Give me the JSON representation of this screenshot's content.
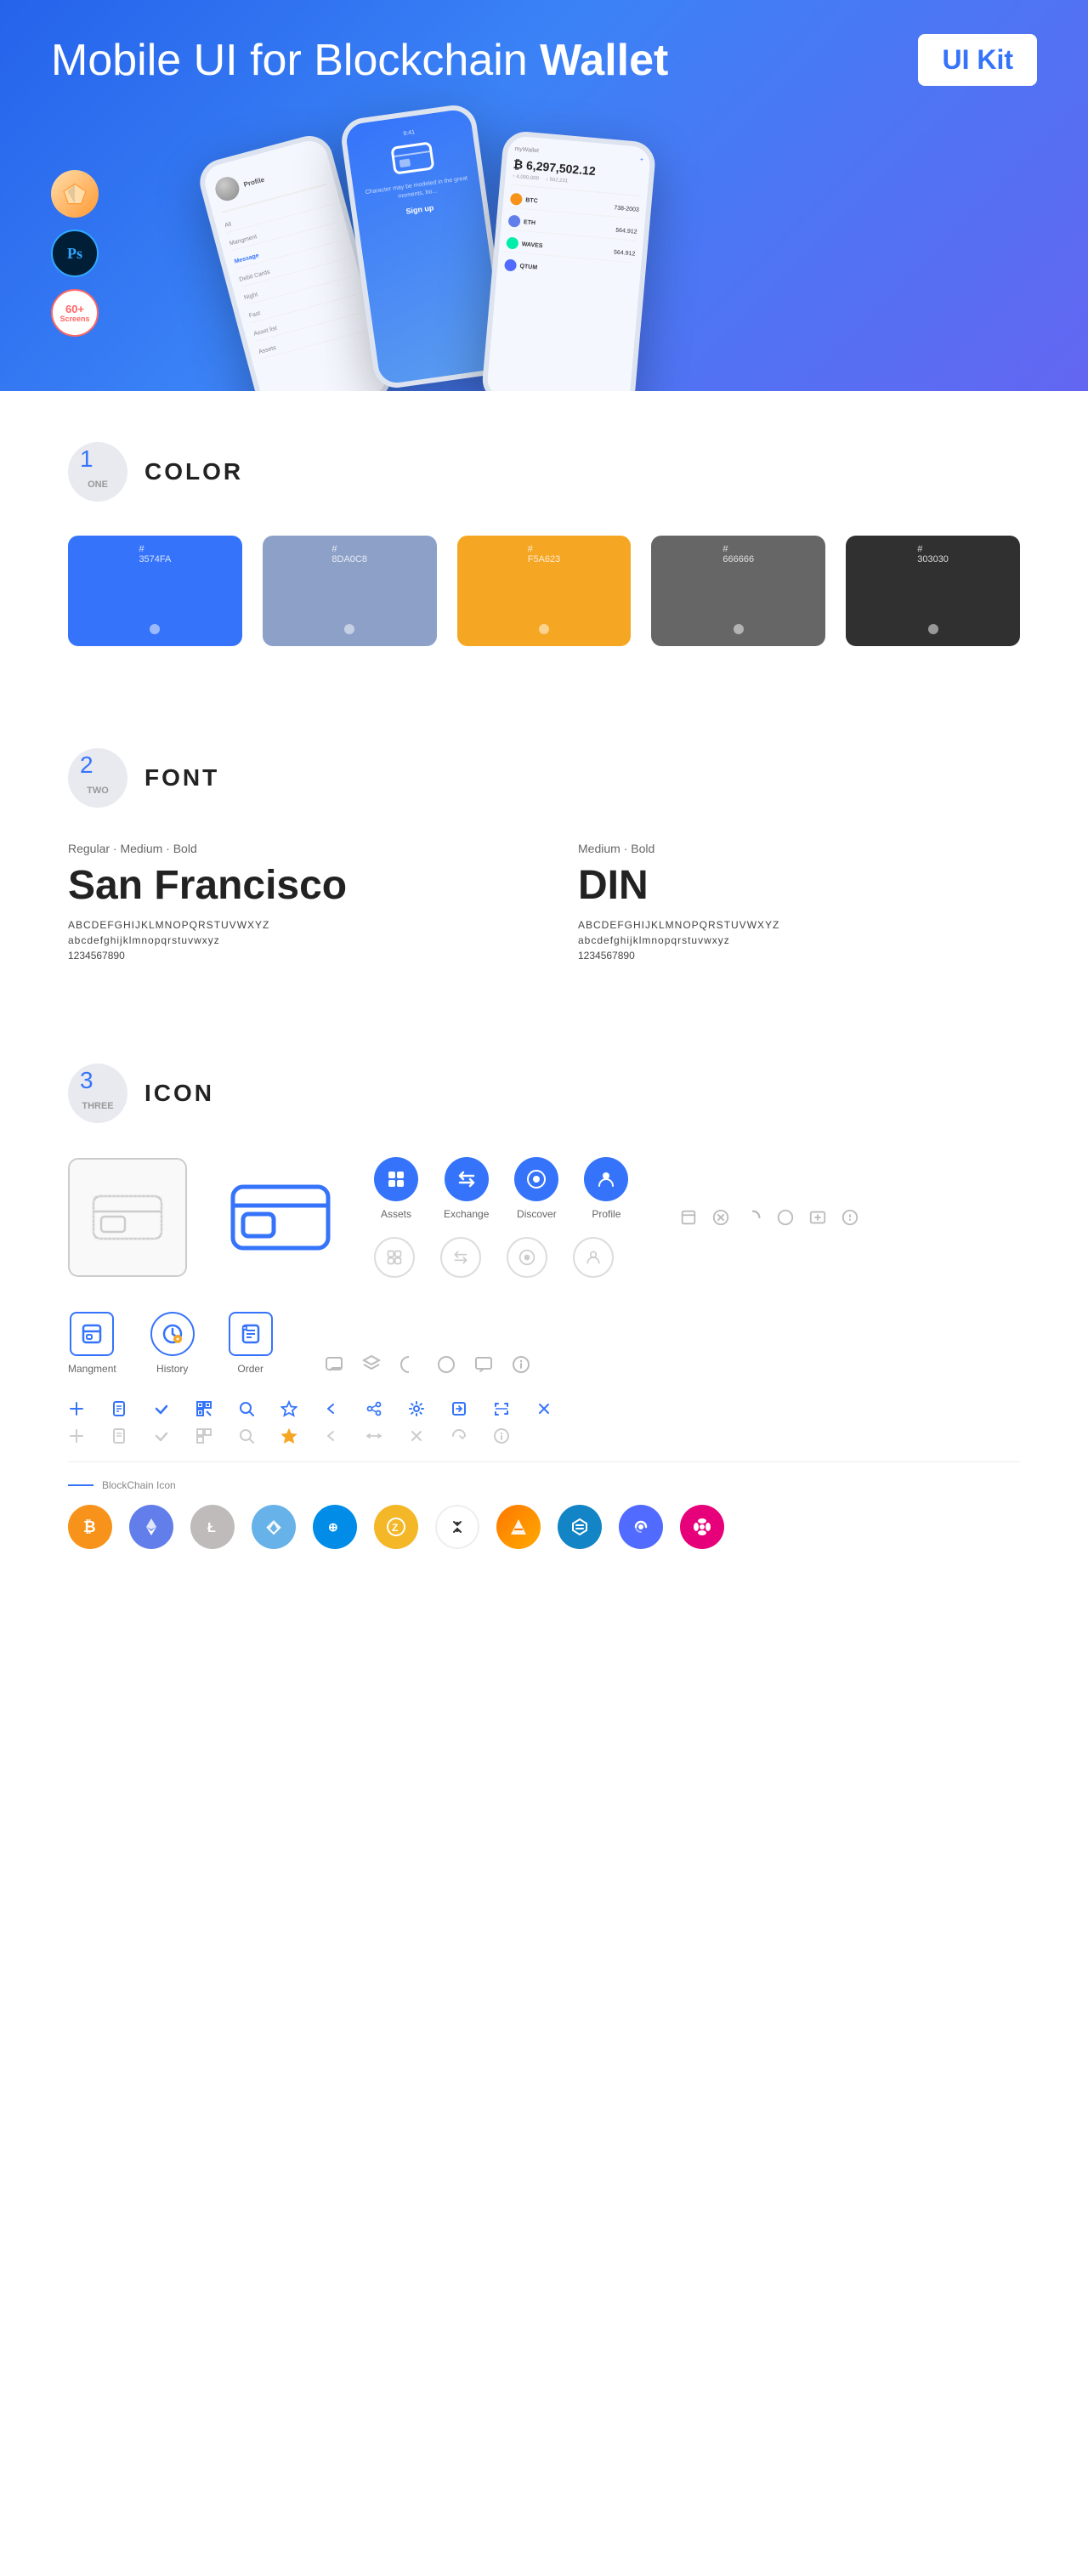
{
  "hero": {
    "title_regular": "Mobile UI for Blockchain ",
    "title_bold": "Wallet",
    "badge": "UI Kit",
    "sketch_label": "Sketch",
    "ps_label": "Ps",
    "screens_label": "60+\nScreens"
  },
  "section1": {
    "number": "1",
    "word": "ONE",
    "title": "COLOR",
    "colors": [
      {
        "hex": "#3574FA",
        "code": "#\n3574FA"
      },
      {
        "hex": "#8DA0C8",
        "code": "#\n8DA0C8"
      },
      {
        "hex": "#F5A623",
        "code": "#\nF5A623"
      },
      {
        "hex": "#666666",
        "code": "#\n666666"
      },
      {
        "hex": "#303030",
        "code": "#\n303030"
      }
    ]
  },
  "section2": {
    "number": "2",
    "word": "TWO",
    "title": "FONT",
    "font1": {
      "weights": "Regular · Medium · Bold",
      "name": "San Francisco",
      "upper": "ABCDEFGHIJKLMNOPQRSTUVWXYZ",
      "lower": "abcdefghijklmnopqrstuvwxyz",
      "nums": "1234567890"
    },
    "font2": {
      "weights": "Medium · Bold",
      "name": "DIN",
      "upper": "ABCDEFGHIJKLMNOPQRSTUVWXYZ",
      "lower": "abcdefghijklmnopqrstuvwxyz",
      "nums": "1234567890"
    }
  },
  "section3": {
    "number": "3",
    "word": "THREE",
    "title": "ICON",
    "nav_icons": [
      {
        "label": "Assets",
        "color": "#3574FA"
      },
      {
        "label": "Exchange",
        "color": "#3574FA"
      },
      {
        "label": "Discover",
        "color": "#3574FA"
      },
      {
        "label": "Profile",
        "color": "#3574FA"
      }
    ],
    "medium_icons": [
      {
        "label": "Mangment"
      },
      {
        "label": "History"
      },
      {
        "label": "Order"
      }
    ],
    "blockchain_label": "BlockChain Icon",
    "crypto_coins": [
      "BTC",
      "ETH",
      "LTC",
      "NEM",
      "DASH",
      "ZEC",
      "IOTA",
      "ARK",
      "STRAT",
      "BAND",
      "DOT"
    ]
  }
}
